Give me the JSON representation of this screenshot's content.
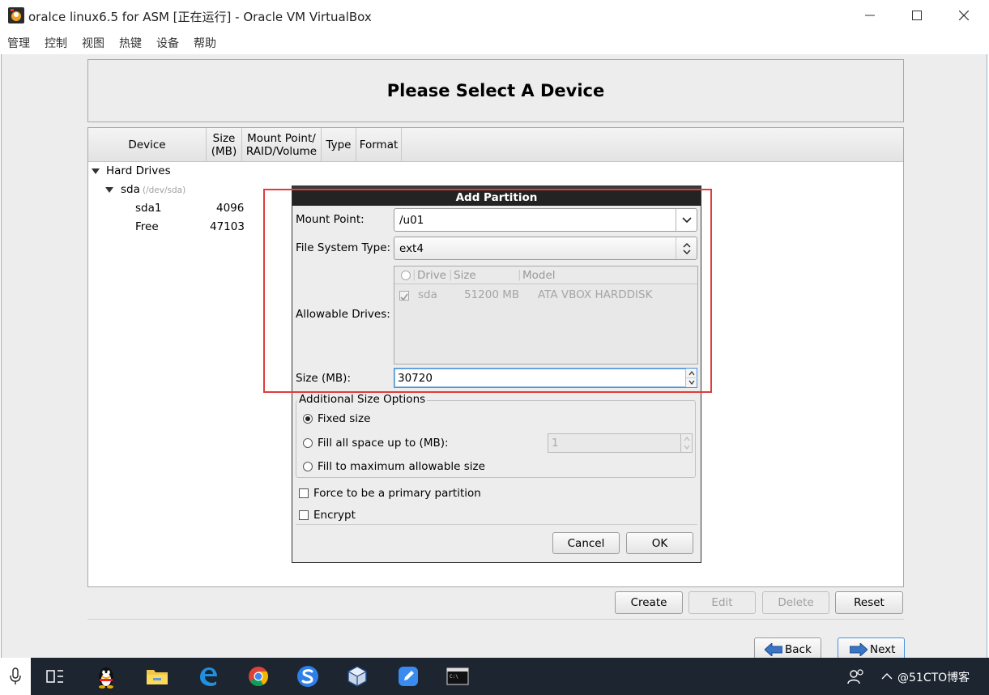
{
  "window": {
    "title": "oralce linux6.5 for ASM [正在运行] - Oracle VM VirtualBox"
  },
  "menu": [
    "管理",
    "控制",
    "视图",
    "热键",
    "设备",
    "帮助"
  ],
  "installer": {
    "heading": "Please Select A Device",
    "columns": [
      "Device",
      "Size\n(MB)",
      "Mount Point/\nRAID/Volume",
      "Type",
      "Format"
    ],
    "tree": {
      "group": "Hard Drives",
      "disk": "sda",
      "disk_path": "(/dev/sda)",
      "rows": [
        {
          "device": "sda1",
          "size": "4096"
        },
        {
          "device": "Free",
          "size": "47103"
        }
      ]
    },
    "buttons": {
      "create": "Create",
      "edit": "Edit",
      "delete": "Delete",
      "reset": "Reset",
      "back": "Back",
      "next": "Next"
    }
  },
  "dialog": {
    "title": "Add Partition",
    "mount_point_label": "Mount Point:",
    "mount_point_value": "/u01",
    "fs_type_label": "File System Type:",
    "fs_type_value": "ext4",
    "allowable_drives_label": "Allowable Drives:",
    "drives_columns": [
      "Drive",
      "Size",
      "Model"
    ],
    "drives": [
      {
        "drive": "sda",
        "size": "51200 MB",
        "model": "ATA VBOX HARDDISK",
        "checked": true
      }
    ],
    "size_label": "Size (MB):",
    "size_value": "30720",
    "additional_options_label": "Additional Size Options",
    "option_fixed": "Fixed size",
    "option_fill_up_to": "Fill all space up to (MB):",
    "option_fill_up_to_value": "1",
    "option_fill_max": "Fill to maximum allowable size",
    "selected_option": "fixed",
    "force_primary": "Force to be a primary partition",
    "encrypt": "Encrypt",
    "cancel": "Cancel",
    "ok": "OK"
  },
  "taskbar": {
    "tray_text": "@51CTO博客"
  },
  "colors": {
    "highlight_box": "#e23b3b",
    "dialog_title_bg": "#232323",
    "taskbar_bg": "#1c2530"
  }
}
